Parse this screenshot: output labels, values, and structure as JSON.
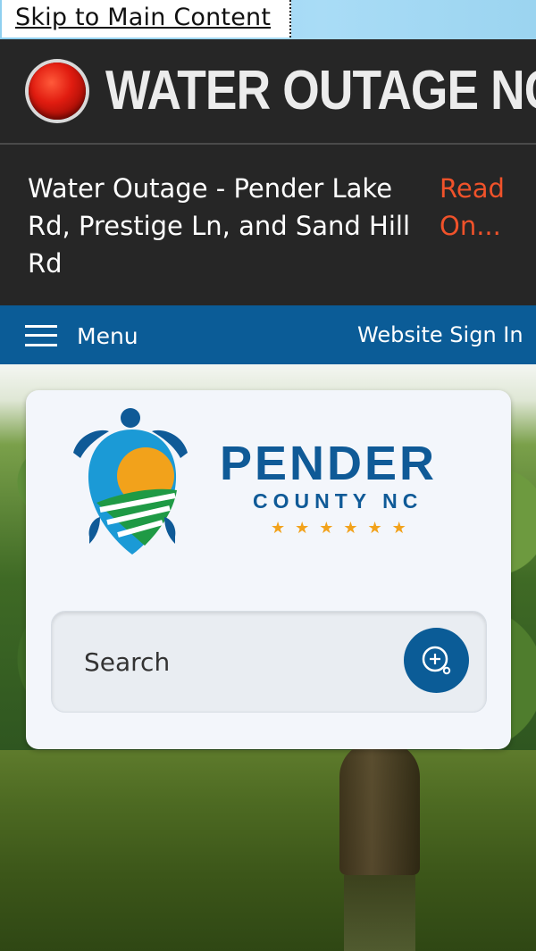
{
  "skip_link": {
    "label": "Skip to Main Content"
  },
  "alert": {
    "title": "WATER OUTAGE NC",
    "message": "Water Outage - Pender Lake Rd, Prestige Ln, and Sand Hill Rd",
    "read_more": "Read On...",
    "colors": {
      "background": "#262626",
      "dot": "#e11c10",
      "link": "#f0522a"
    }
  },
  "navbar": {
    "menu_label": "Menu",
    "sign_in_label": "Website Sign In",
    "color": "#0b5c97"
  },
  "logo": {
    "name": "PENDER",
    "subtitle": "COUNTY NC",
    "stars": "★★★★★★",
    "icon": "turtle-icon"
  },
  "search": {
    "placeholder": "Search",
    "value": "",
    "button_icon": "search-icon"
  }
}
